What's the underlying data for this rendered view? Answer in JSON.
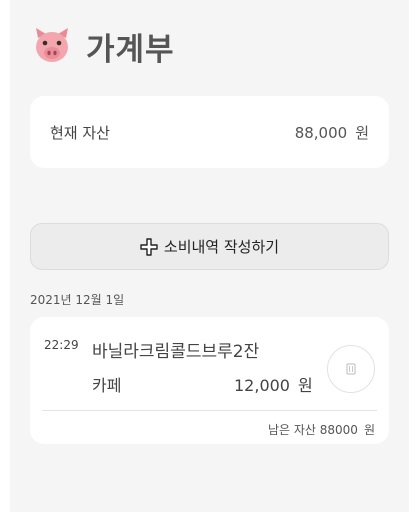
{
  "header": {
    "title": "가계부",
    "icon": "pig-face-icon"
  },
  "asset": {
    "label": "현재 자산",
    "value": "88,000",
    "unit": "원"
  },
  "add_button": {
    "label": "소비내역 작성하기",
    "icon": "plus-icon"
  },
  "groups": [
    {
      "date": "2021년 12월 1일",
      "transactions": [
        {
          "time": "22:29",
          "name": "바닐라크림콜드브루2잔",
          "category": "카페",
          "amount": "12,000",
          "amount_unit": "원",
          "remaining_label": "남은 자산",
          "remaining_value": "88000",
          "remaining_unit": "원"
        }
      ]
    }
  ],
  "colors": {
    "background": "#f5f5f5",
    "card": "#ffffff",
    "pig": "#f4a6ae"
  }
}
